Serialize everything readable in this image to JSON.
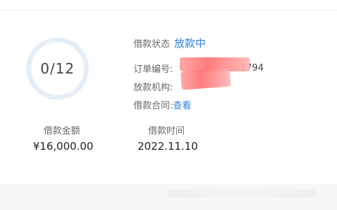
{
  "progress": {
    "text": "0/12",
    "fraction": 0.0
  },
  "status": {
    "label": "借款状态",
    "value": "放款中"
  },
  "order": {
    "label": "订单编号:",
    "value_visible": "1794"
  },
  "lender": {
    "label": "放款机构:"
  },
  "contract": {
    "label": "借款合同:",
    "link": "查看"
  },
  "amount": {
    "label": "借款金额",
    "value": "¥16,000.00"
  },
  "date": {
    "label": "借款时间",
    "value": "2022.11.10"
  },
  "colors": {
    "accent": "#2f80e0",
    "ring": "#e6eef5",
    "redaction": "#ff6b6b"
  }
}
